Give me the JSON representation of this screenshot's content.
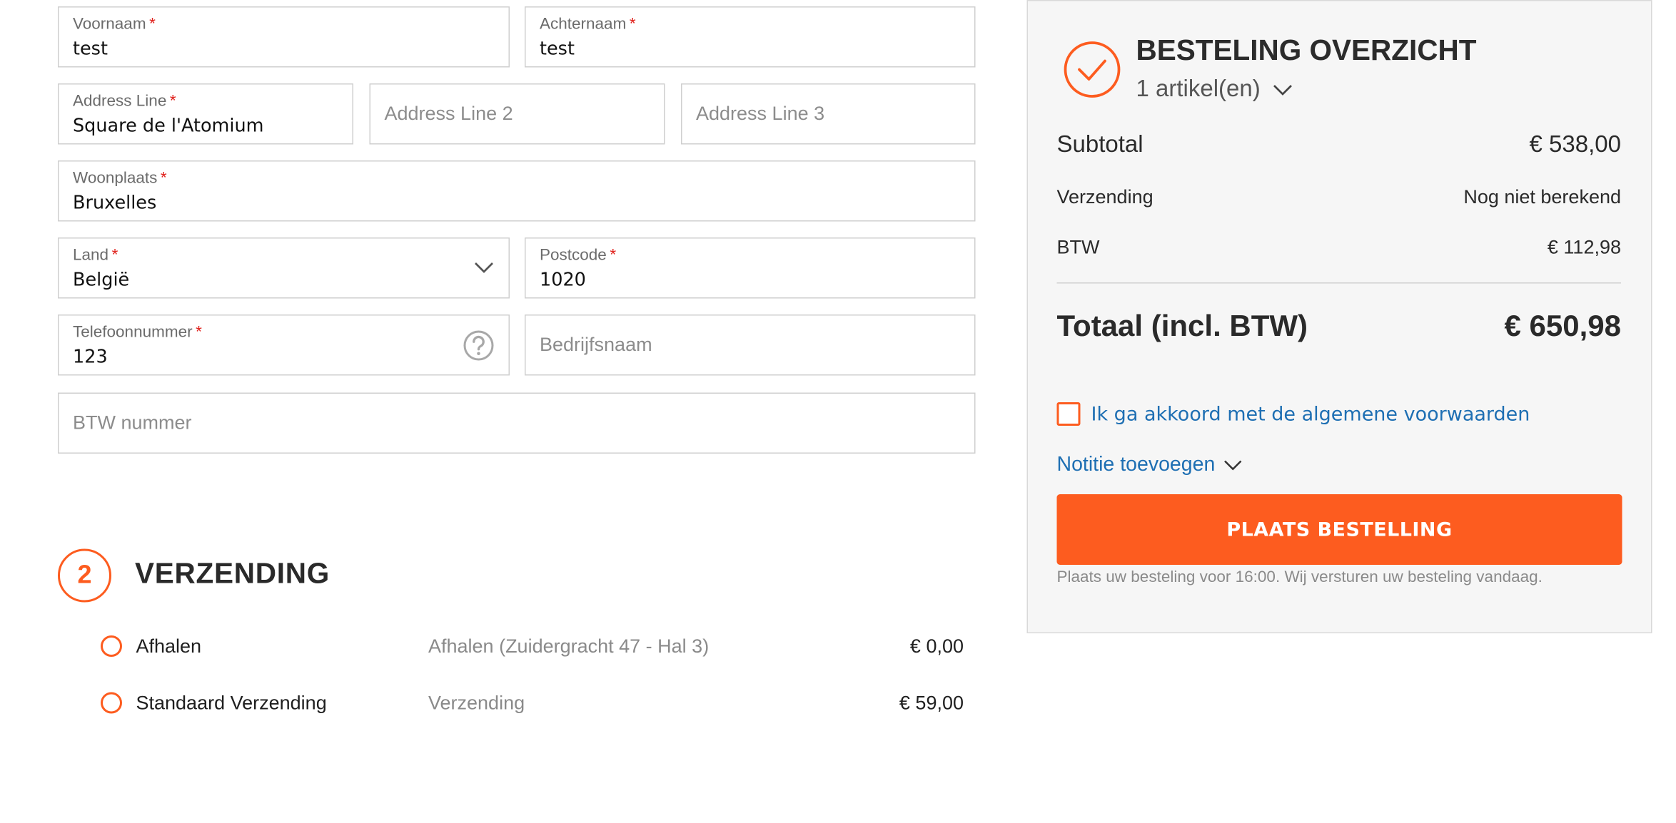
{
  "form": {
    "firstname": {
      "label": "Voornaam",
      "required": "*",
      "value": "test"
    },
    "lastname": {
      "label": "Achternaam",
      "required": "*",
      "value": "test"
    },
    "address1": {
      "label": "Address Line",
      "required": "*",
      "value": "Square de l'Atomium"
    },
    "address2": {
      "placeholder": "Address Line 2"
    },
    "address3": {
      "placeholder": "Address Line 3"
    },
    "city": {
      "label": "Woonplaats",
      "required": "*",
      "value": "Bruxelles"
    },
    "country": {
      "label": "Land",
      "required": "*",
      "value": "België"
    },
    "postcode": {
      "label": "Postcode",
      "required": "*",
      "value": "1020"
    },
    "phone": {
      "label": "Telefoonnummer",
      "required": "*",
      "value": "123"
    },
    "company": {
      "placeholder": "Bedrijfsnaam"
    },
    "vat": {
      "placeholder": "BTW nummer"
    }
  },
  "shipping": {
    "step_number": "2",
    "title": "VERZENDING",
    "options": [
      {
        "name": "Afhalen",
        "description": "Afhalen (Zuidergracht 47 - Hal 3)",
        "price": "€ 0,00"
      },
      {
        "name": "Standaard Verzending",
        "description": "Verzending",
        "price": "€ 59,00"
      }
    ]
  },
  "summary": {
    "title": "BESTELING OVERZICHT",
    "item_count": "1 artikel(en)",
    "subtotal_label": "Subtotal",
    "subtotal_value": "€ 538,00",
    "shipping_label": "Verzending",
    "shipping_value": "Nog niet berekend",
    "vat_label": "BTW",
    "vat_value": "€ 112,98",
    "total_label": "Totaal (incl. BTW)",
    "total_value": "€ 650,98",
    "terms_label": "Ik ga akkoord met de algemene voorwaarden",
    "note_link": "Notitie toevoegen",
    "place_order_label": "PLAATS BESTELLING",
    "place_order_note": "Plaats uw besteling voor 16:00. Wij versturen uw besteling vandaag."
  },
  "colors": {
    "accent": "#fd5c1f",
    "link": "#1e6fb3",
    "required": "#e0201b"
  },
  "icons": {
    "summary": "check-circle-icon",
    "dropdown": "chevron-down-icon",
    "help": "question-circle-icon"
  }
}
